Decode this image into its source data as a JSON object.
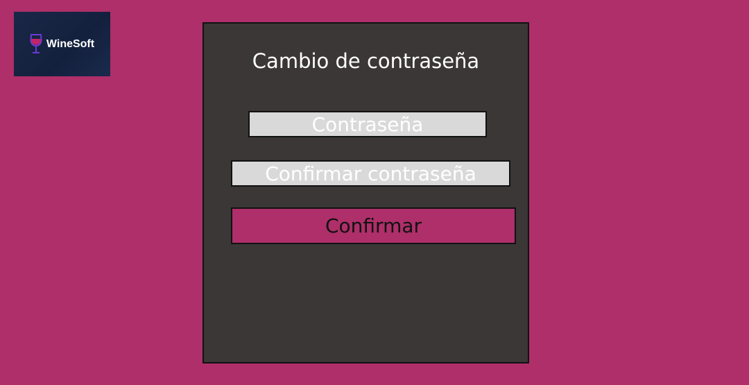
{
  "brand": {
    "name": "WineSoft",
    "logo_icon": "wine-glass-icon",
    "background_color": "#1a2747"
  },
  "colors": {
    "page_background": "#ae2f69",
    "panel_background": "#3a3736",
    "field_background": "#d9d9d9",
    "button_background": "#ae2f69"
  },
  "form": {
    "title": "Cambio de contraseña",
    "password_placeholder": "Contraseña",
    "confirm_password_placeholder": "Confirmar contraseña",
    "submit_label": "Confirmar"
  }
}
